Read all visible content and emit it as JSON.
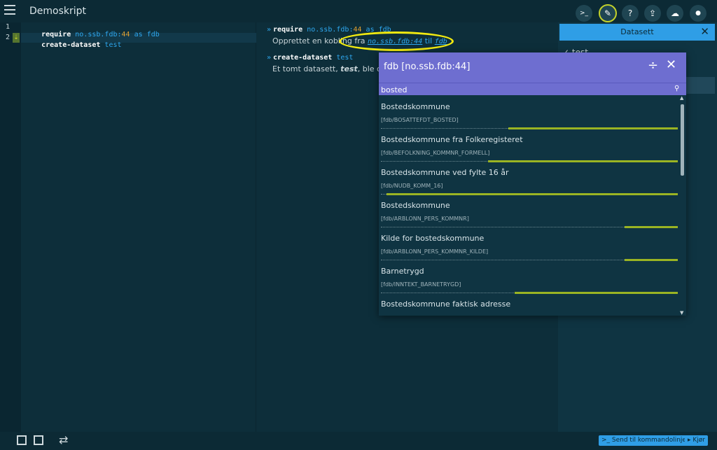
{
  "app": {
    "title": "Demoskript"
  },
  "toolbar": {
    "buttons": [
      {
        "icon": "terminal-icon",
        "glyph": ">_"
      },
      {
        "icon": "edit-icon",
        "glyph": "✎"
      },
      {
        "icon": "help-icon",
        "glyph": "?"
      },
      {
        "icon": "share-icon",
        "glyph": "⇪"
      },
      {
        "icon": "cloud-icon",
        "glyph": "☁"
      },
      {
        "icon": "user-icon",
        "glyph": "●"
      }
    ]
  },
  "editor": {
    "line_numbers": [
      "1",
      "2"
    ],
    "lines": [
      {
        "kw": "require",
        "ns": "no.ssb.fdb",
        "colon": ":",
        "num": "44",
        "as": "as",
        "alias": "fdb"
      },
      {
        "kw": "create-dataset",
        "arg": "test"
      }
    ]
  },
  "output": {
    "blocks": [
      {
        "cmd_kw": "require",
        "cmd_rest": "no.ssb.fdb",
        "cmd_num": "44",
        "cmd_tail": "as fdb",
        "text_prefix": "Opprettet en kobling fra ",
        "link1": "no.ssb.fdb:44",
        "link_mid": " til ",
        "link2": "fdb"
      },
      {
        "cmd_kw": "create-dataset",
        "cmd_arg": "test",
        "text_prefix": "Et tomt datasett, ",
        "text_em": "test",
        "text_suffix": ", ble opp"
      }
    ]
  },
  "datasett_panel": {
    "title": "Datasett",
    "item": "✓ test"
  },
  "popup": {
    "title": "fdb [no.ssb.fdb:44]",
    "search_value": "bosted",
    "results": [
      {
        "name": "Bostedskommune",
        "path": "[fdb/BOSATTEFDT_BOSTED]",
        "relevance": 0.57
      },
      {
        "name": "Bostedskommune fra Folkeregisteret",
        "path": "[fdb/BEFOLKNING_KOMMNR_FORMELL]",
        "relevance": 0.64
      },
      {
        "name": "Bostedskommune ved fylte 16 år",
        "path": "[fdb/NUDB_KOMM_16]",
        "relevance": 0.98
      },
      {
        "name": "Bostedskommune",
        "path": "[fdb/ARBLONN_PERS_KOMMNR]",
        "relevance": 0.18
      },
      {
        "name": "Kilde for bostedskommune",
        "path": "[fdb/ARBLONN_PERS_KOMMNR_KILDE]",
        "relevance": 0.18
      },
      {
        "name": "Barnetrygd",
        "path": "[fdb/INNTEKT_BARNETRYGD]",
        "relevance": 0.55
      },
      {
        "name": "Bostedskommune faktisk adresse",
        "path": "",
        "relevance": 0
      }
    ]
  },
  "bottombar": {
    "send_label": "Send til kommandolinjen",
    "run_label": "Kjør"
  }
}
